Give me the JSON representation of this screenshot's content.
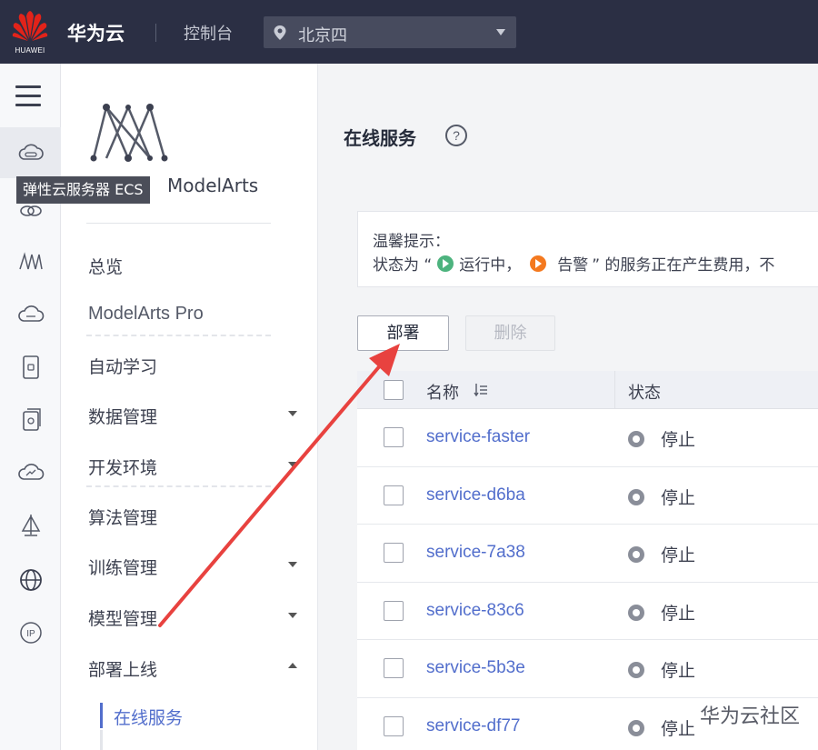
{
  "header": {
    "logo_text": "HUAWEI",
    "brand": "华为云",
    "console": "控制台",
    "region": "北京四"
  },
  "rail": {
    "tooltip": "弹性云服务器 ECS",
    "icons": [
      "menu-icon",
      "cloud-server-icon",
      "link-icon",
      "modelarts-icon",
      "cloud-disk-icon",
      "storage-icon",
      "database-icon",
      "cloud-monitor-icon",
      "network-icon",
      "globe-icon",
      "ip-icon"
    ]
  },
  "menu": {
    "product_name": "ModelArts",
    "items": [
      {
        "label": "总览"
      },
      {
        "label": "ModelArts Pro"
      },
      {
        "label": "自动学习"
      },
      {
        "label": "数据管理"
      },
      {
        "label": "开发环境"
      },
      {
        "label": "算法管理"
      },
      {
        "label": "训练管理"
      },
      {
        "label": "模型管理"
      },
      {
        "label": "部署上线"
      }
    ],
    "sub_item": "在线服务"
  },
  "main": {
    "title": "在线服务",
    "help": "?",
    "notice_title": "温馨提示：",
    "notice_pre": "状态为 “",
    "notice_running": "运行中，",
    "notice_warn": "告警",
    "notice_post": "” 的服务正在产生费用，不",
    "deploy_button": "部署",
    "delete_button": "删除",
    "col_name": "名称",
    "col_status": "状态",
    "rows": [
      {
        "name": "service-faster",
        "status": "停止"
      },
      {
        "name": "service-d6ba",
        "status": "停止"
      },
      {
        "name": "service-7a38",
        "status": "停止"
      },
      {
        "name": "service-83c6",
        "status": "停止"
      },
      {
        "name": "service-5b3e",
        "status": "停止"
      },
      {
        "name": "service-df77",
        "status": "停止"
      }
    ]
  },
  "watermark": "华为云社区",
  "colors": {
    "topbar": "#2b2f44",
    "link": "#526ecc",
    "arrow": "#e8423f",
    "running": "#4db37e",
    "warning": "#f4791f",
    "stopped": "#8a8e99"
  }
}
